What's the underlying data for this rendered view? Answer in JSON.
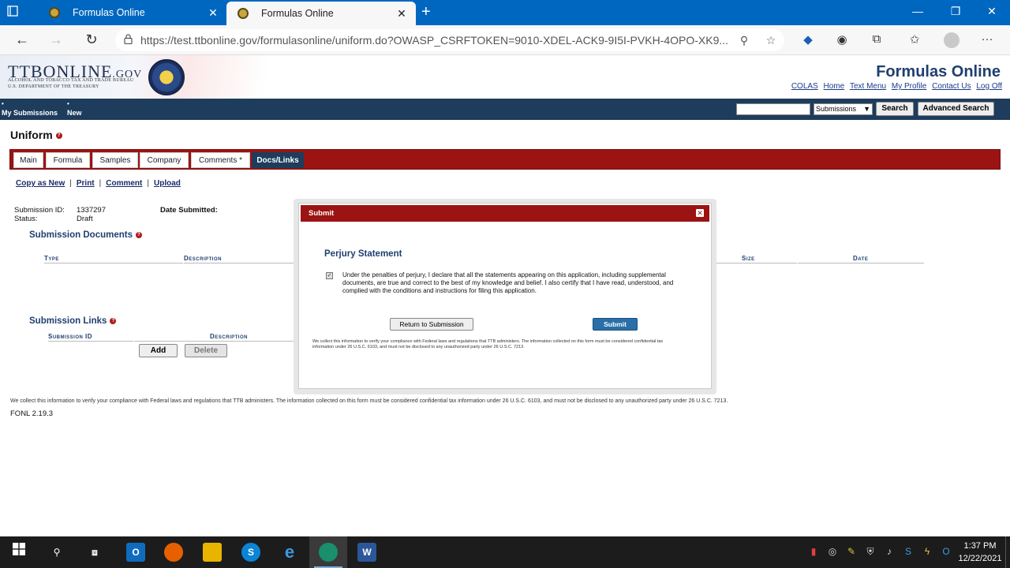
{
  "browser": {
    "tabs": [
      {
        "title": "Formulas Online",
        "active": false
      },
      {
        "title": "Formulas Online",
        "active": true
      }
    ],
    "url": "https://test.ttbonline.gov/formulasonline/uniform.do?OWASP_CSRFTOKEN=9010-XDEL-ACK9-9I5I-PVKH-4OPO-XK9..."
  },
  "site": {
    "logo_main": "TTBONLINE",
    "logo_suffix": ".GOV",
    "logo_sub1": "ALCOHOL AND TOBACCO TAX AND TRADE BUREAU",
    "logo_sub2": "U.S. DEPARTMENT OF THE TREASURY",
    "title": "Formulas Online",
    "links": [
      "COLAS",
      "Home",
      "Text Menu",
      "My Profile",
      "Contact Us",
      "Log Off"
    ]
  },
  "nav": {
    "my_submissions": "My Submissions",
    "new": "New",
    "search_scope": "Submissions",
    "search_button": "Search",
    "advanced_search": "Advanced Search"
  },
  "page": {
    "title": "Uniform",
    "tabs": [
      "Main",
      "Formula",
      "Samples",
      "Company",
      "Comments *",
      "Docs/Links"
    ],
    "active_tab": "Docs/Links",
    "actions": [
      "Copy as New",
      "Print",
      "Comment",
      "Upload"
    ],
    "submission_id_label": "Submission ID:",
    "submission_id": "1337297",
    "status_label": "Status:",
    "status": "Draft",
    "date_submitted_label": "Date Submitted:",
    "docs_heading": "Submission Documents",
    "docs_columns": [
      "Type",
      "Description",
      "Size",
      "Date"
    ],
    "links_heading": "Submission Links",
    "links_columns": [
      "Submission ID",
      "Description"
    ],
    "add_button": "Add",
    "delete_button": "Delete",
    "footer_note": "We collect this information to verify your compliance with Federal laws and regulations that TTB administers. The information collected on this form must be considered confidential tax information under 26 U.S.C. 6103, and must not be disclosed to any unauthorized party under 26 U.S.C. 7213.",
    "version": "FONL 2.19.3"
  },
  "modal": {
    "title": "Submit",
    "heading": "Perjury Statement",
    "checked": true,
    "statement": "Under the penalties of perjury, I declare that all the statements appearing on this application, including supplemental documents, are true and correct to the best of my knowledge and belief. I also certify that I have read, understood, and complied with the conditions and instructions for filing this application.",
    "return_button": "Return to Submission",
    "submit_button": "Submit",
    "note": "We collect this information to verify your compliance with Federal laws and regulations that TTB administers. The information collected on this form must be considered confidential tax information under 26 U.S.C. 6103, and must not be disclosed to any unauthorized party under 26 U.S.C. 7213."
  },
  "taskbar": {
    "time": "1:37 PM",
    "date": "12/22/2021"
  }
}
